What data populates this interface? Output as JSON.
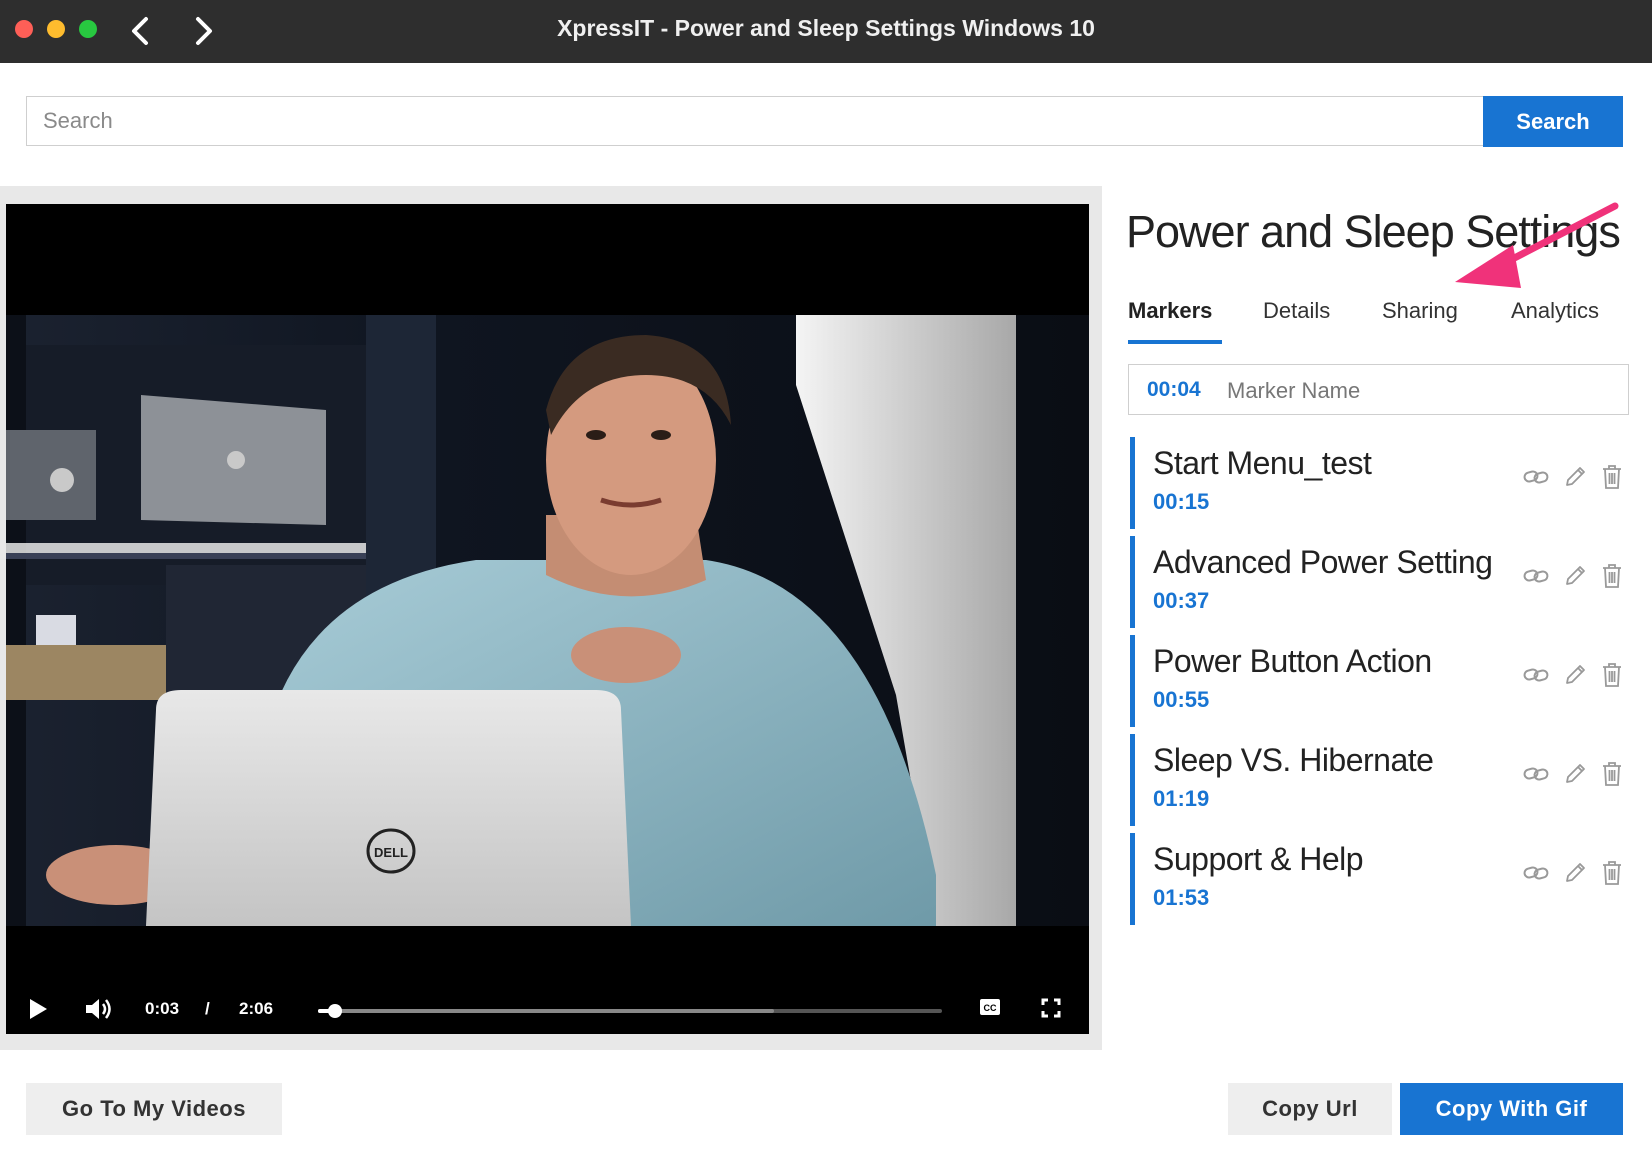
{
  "window": {
    "title": "XpressIT - Power and Sleep Settings Windows 10"
  },
  "search": {
    "placeholder": "Search",
    "button_label": "Search"
  },
  "player": {
    "current_time": "0:03",
    "separator": "/",
    "duration": "2:06",
    "played_fraction": 0.027,
    "buffered_fraction": 0.73,
    "laptop_logo": "DELL"
  },
  "panel": {
    "title": "Power and Sleep Settings ...",
    "tabs": [
      {
        "label": "Markers",
        "active": true
      },
      {
        "label": "Details",
        "active": false
      },
      {
        "label": "Sharing",
        "active": false
      },
      {
        "label": "Analytics",
        "active": false
      }
    ],
    "new_marker": {
      "time": "00:04",
      "placeholder": "Marker Name"
    },
    "markers": [
      {
        "name": "Start Menu_test",
        "time": "00:15"
      },
      {
        "name": "Advanced Power Setting",
        "time": "00:37"
      },
      {
        "name": "Power Button Action",
        "time": "00:55"
      },
      {
        "name": "Sleep VS. Hibernate",
        "time": "01:19"
      },
      {
        "name": "Support & Help",
        "time": "01:53"
      }
    ]
  },
  "footer": {
    "my_videos_label": "Go To My Videos",
    "copy_url_label": "Copy Url",
    "copy_gif_label": "Copy With Gif"
  },
  "colors": {
    "accent": "#1874d2",
    "titlebar": "#2e2e2e",
    "annotation_arrow": "#f0327a"
  }
}
